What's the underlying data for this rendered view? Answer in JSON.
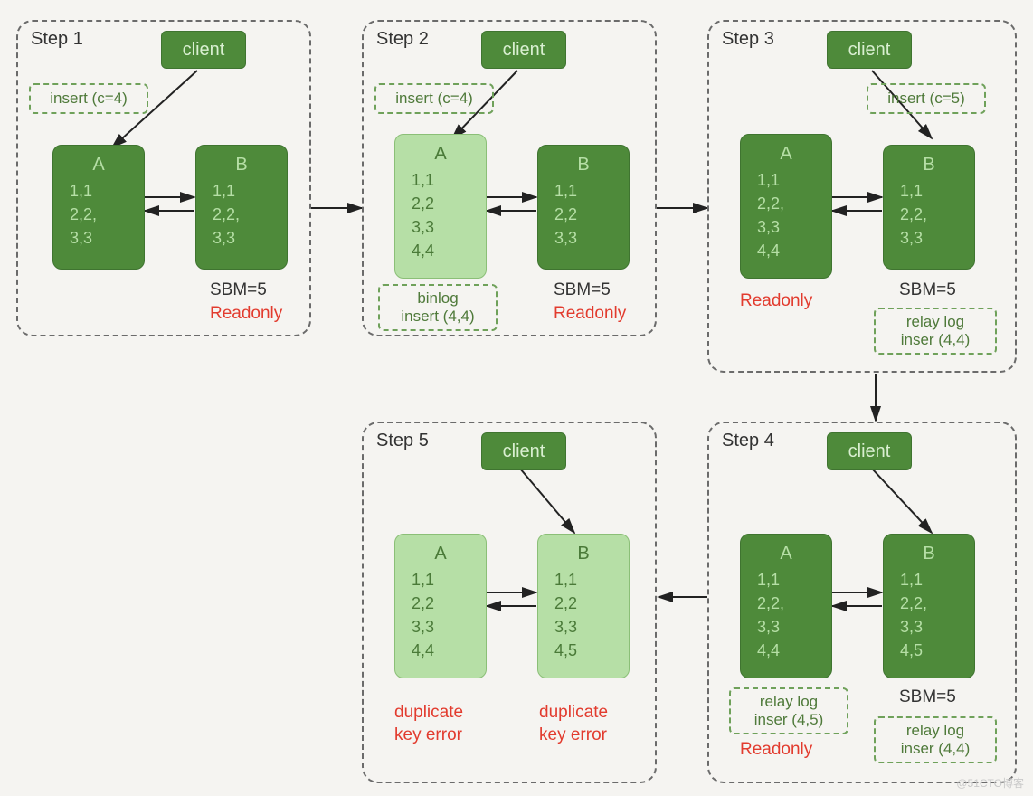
{
  "watermark": "@51CTO博客",
  "client_label": "client",
  "steps": {
    "s1": {
      "title": "Step 1",
      "insert": "insert (c=4)",
      "A": {
        "hdr": "A",
        "rows": [
          "1,1",
          "2,2,",
          "3,3"
        ]
      },
      "B": {
        "hdr": "B",
        "rows": [
          "1,1",
          "2,2,",
          "3,3"
        ]
      },
      "sbm": "SBM=5",
      "readonly": "Readonly"
    },
    "s2": {
      "title": "Step 2",
      "insert": "insert (c=4)",
      "A": {
        "hdr": "A",
        "rows": [
          "1,1",
          "2,2",
          "3,3",
          "4,4"
        ]
      },
      "B": {
        "hdr": "B",
        "rows": [
          "1,1",
          "2,2",
          "3,3"
        ]
      },
      "binlog_l1": "binlog",
      "binlog_l2": "insert (4,4)",
      "sbm": "SBM=5",
      "readonly": "Readonly"
    },
    "s3": {
      "title": "Step 3",
      "insert": "insert (c=5)",
      "A": {
        "hdr": "A",
        "rows": [
          "1,1",
          "2,2,",
          "3,3",
          "4,4"
        ]
      },
      "B": {
        "hdr": "B",
        "rows": [
          "1,1",
          "2,2,",
          "3,3"
        ]
      },
      "readonly": "Readonly",
      "sbm": "SBM=5",
      "relay_l1": "relay log",
      "relay_l2": "inser (4,4)"
    },
    "s4": {
      "title": "Step 4",
      "A": {
        "hdr": "A",
        "rows": [
          "1,1",
          "2,2,",
          "3,3",
          "4,4"
        ]
      },
      "B": {
        "hdr": "B",
        "rows": [
          "1,1",
          "2,2,",
          "3,3",
          "4,5"
        ]
      },
      "relayA_l1": "relay log",
      "relayA_l2": "inser (4,5)",
      "readonly": "Readonly",
      "sbm": "SBM=5",
      "relayB_l1": "relay log",
      "relayB_l2": "inser (4,4)"
    },
    "s5": {
      "title": "Step 5",
      "A": {
        "hdr": "A",
        "rows": [
          "1,1",
          "2,2",
          "3,3",
          "4,4"
        ]
      },
      "B": {
        "hdr": "B",
        "rows": [
          "1,1",
          "2,2",
          "3,3",
          "4,5"
        ]
      },
      "errA_l1": "duplicate",
      "errA_l2": "key error",
      "errB_l1": "duplicate",
      "errB_l2": "key error"
    }
  }
}
